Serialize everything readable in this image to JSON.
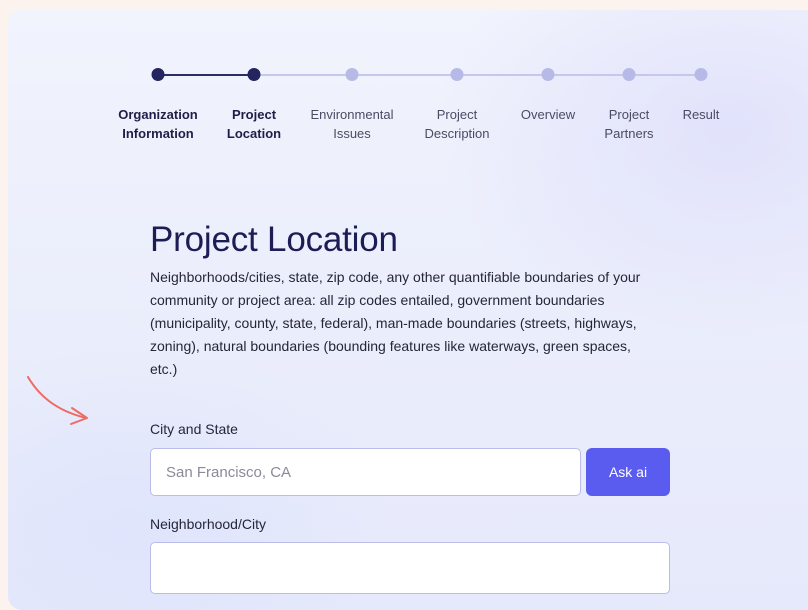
{
  "steps": [
    {
      "line1": "Organization",
      "line2": "Information",
      "state": "done"
    },
    {
      "line1": "Project",
      "line2": "Location",
      "state": "current"
    },
    {
      "line1": "Environmental",
      "line2": "Issues",
      "state": "todo"
    },
    {
      "line1": "Project",
      "line2": "Description",
      "state": "todo"
    },
    {
      "line1": "Overview",
      "line2": "",
      "state": "todo"
    },
    {
      "line1": "Project",
      "line2": "Partners",
      "state": "todo"
    },
    {
      "line1": "Result",
      "line2": "",
      "state": "todo"
    }
  ],
  "page": {
    "title": "Project Location",
    "description": "Neighborhoods/cities, state, zip code, any other quantifiable boundaries of your community or project area: all zip codes entailed, government boundaries (municipality, county, state, federal), man-made boundaries (streets, highways, zoning), natural boundaries (bounding features like waterways, green spaces, etc.)"
  },
  "form": {
    "city_state_label": "City and State",
    "city_state_placeholder": "San Francisco, CA",
    "city_state_value": "",
    "ask_ai_label": "Ask ai",
    "neighborhood_label": "Neighborhood/City",
    "neighborhood_value": ""
  },
  "colors": {
    "accent": "#5a5cef",
    "step_done": "#24245e",
    "step_todo": "#b7bae6",
    "annotation_arrow": "#ee6b62"
  }
}
